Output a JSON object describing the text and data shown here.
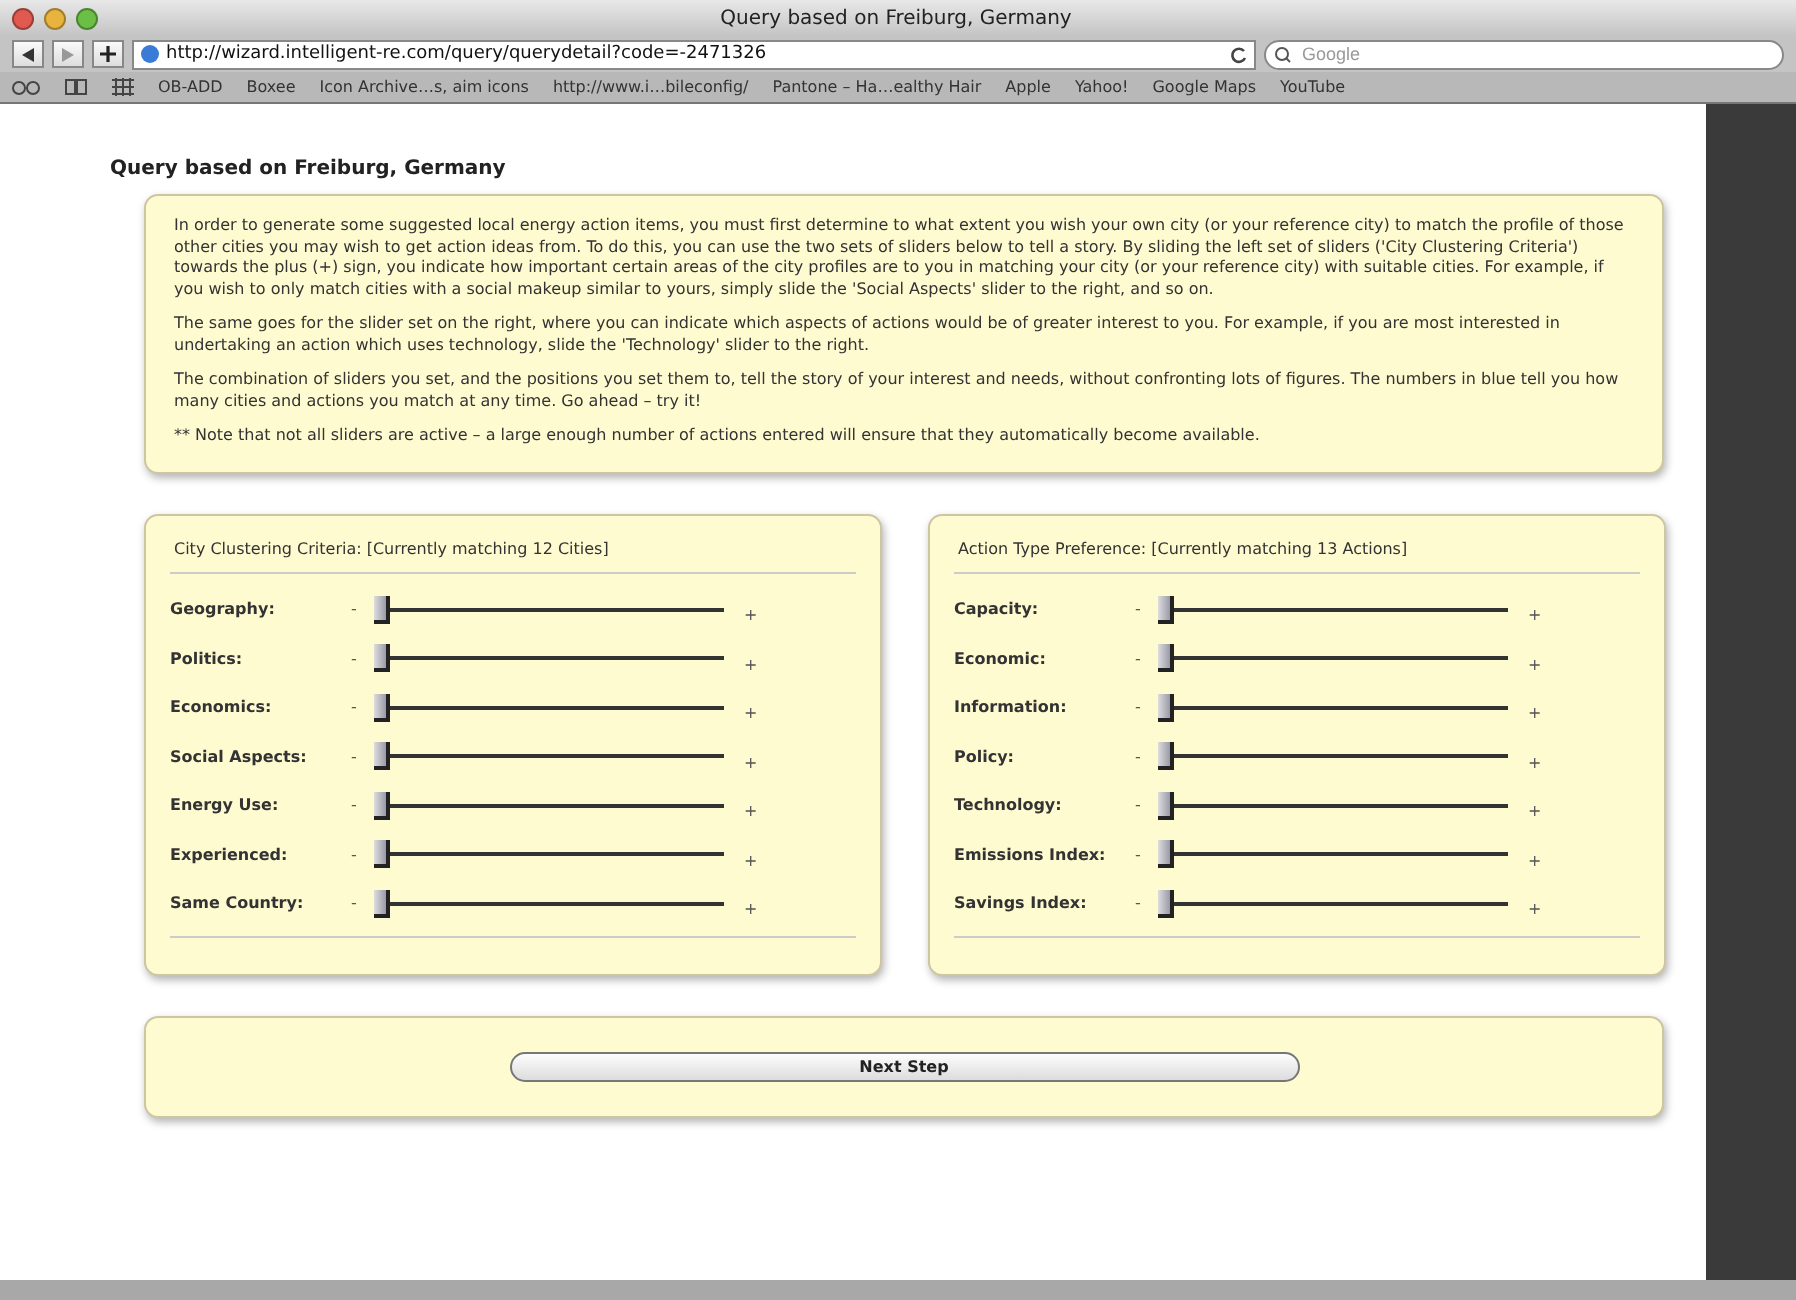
{
  "window": {
    "title": "Query based on Freiburg, Germany"
  },
  "toolbar": {
    "url": "http://wizard.intelligent-re.com/query/querydetail?code=-2471326",
    "search_placeholder": "Google"
  },
  "bookmarks": [
    "OB-ADD",
    "Boxee",
    "Icon Archive…s, aim icons",
    "http://www.i…bileconfig/",
    "Pantone – Ha…ealthy Hair",
    "Apple",
    "Yahoo!",
    "Google Maps",
    "YouTube"
  ],
  "page": {
    "heading": "Query based on Freiburg, Germany",
    "intro": [
      "In order to generate some suggested local energy action items, you must first determine to what extent you wish your own city (or your reference city) to match the profile of those other cities you may wish to get action ideas from. To do this, you can use the two sets of sliders below to tell a story. By sliding the left set of sliders ('City Clustering Criteria') towards the plus (+) sign, you indicate how important certain areas of the city profiles are to you in matching your city (or your reference city) with suitable cities. For example, if you wish to only match cities with a social makeup similar to yours, simply slide the 'Social Aspects' slider to the right, and so on.",
      "The same goes for the slider set on the right, where you can indicate which aspects of actions would be of greater interest to you. For example, if you are most interested in undertaking an action which uses technology, slide the 'Technology' slider to the right.",
      "The combination of sliders you set, and the positions you set them to, tell the story of your interest and needs, without confronting lots of figures. The numbers in blue tell you how many cities and actions you match at any time. Go ahead – try it!",
      "** Note that not all sliders are active – a large enough number of actions entered will ensure that they automatically become available."
    ],
    "panels": [
      {
        "title": "City Clustering Criteria: [Currently matching 12 Cities]",
        "sliders": [
          {
            "label": "Geography:",
            "minus": "-",
            "plus": "+",
            "level": 0
          },
          {
            "label": "Politics:",
            "minus": "-",
            "plus": "+",
            "level": 0
          },
          {
            "label": "Economics:",
            "minus": "-",
            "plus": "+",
            "level": 0
          },
          {
            "label": "Social Aspects:",
            "minus": "-",
            "plus": "+",
            "level": 0
          },
          {
            "label": "Energy Use:",
            "minus": "-",
            "plus": "+",
            "level": 0
          },
          {
            "label": "Experienced:",
            "minus": "-",
            "plus": "+",
            "level": 0
          },
          {
            "label": "Same Country:",
            "minus": "-",
            "plus": "+",
            "level": 0
          }
        ]
      },
      {
        "title": "Action Type Preference: [Currently matching 13 Actions]",
        "sliders": [
          {
            "label": "Capacity:",
            "minus": "-",
            "plus": "+",
            "level": 0
          },
          {
            "label": "Economic:",
            "minus": "-",
            "plus": "+",
            "level": 0
          },
          {
            "label": "Information:",
            "minus": "-",
            "plus": "+",
            "level": 0
          },
          {
            "label": "Policy:",
            "minus": "-",
            "plus": "+",
            "level": 0
          },
          {
            "label": "Technology:",
            "minus": "-",
            "plus": "+",
            "level": 0
          },
          {
            "label": "Emissions Index:",
            "minus": "-",
            "plus": "+",
            "level": 0
          },
          {
            "label": "Savings Index:",
            "minus": "-",
            "plus": "+",
            "level": 0
          }
        ]
      }
    ],
    "next_button": "Next Step"
  }
}
